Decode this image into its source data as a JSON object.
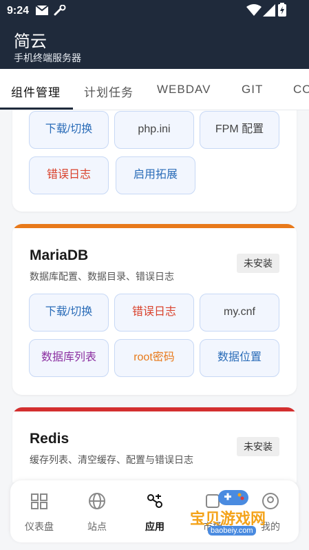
{
  "status": {
    "time": "9:24"
  },
  "app": {
    "title": "简云",
    "subtitle": "手机终端服务器"
  },
  "tabs": [
    {
      "label": "组件管理",
      "active": true
    },
    {
      "label": "计划任务"
    },
    {
      "label": "WEBDAV"
    },
    {
      "label": "GIT"
    },
    {
      "label": "CO"
    }
  ],
  "php_card": {
    "buttons": [
      {
        "label": "下载/切换",
        "color": "#2a6cb8"
      },
      {
        "label": "php.ini",
        "color": "#444444"
      },
      {
        "label": "FPM 配置",
        "color": "#444444"
      },
      {
        "label": "错误日志",
        "color": "#d9412b"
      },
      {
        "label": "启用拓展",
        "color": "#2a6cb8"
      }
    ]
  },
  "mariadb": {
    "title": "MariaDB",
    "desc": "数据库配置、数据目录、错误日志",
    "badge": "未安装",
    "accent": "#e8791a",
    "buttons": [
      {
        "label": "下载/切换",
        "color": "#2a6cb8"
      },
      {
        "label": "错误日志",
        "color": "#d9412b"
      },
      {
        "label": "my.cnf",
        "color": "#444444"
      },
      {
        "label": "数据库列表",
        "color": "#8b2fa0"
      },
      {
        "label": "root密码",
        "color": "#e8791a"
      },
      {
        "label": "数据位置",
        "color": "#2a6cb8"
      }
    ]
  },
  "redis": {
    "title": "Redis",
    "desc": "缓存列表、清空缓存、配置与错误日志",
    "badge": "未安装",
    "accent": "#d32f2f"
  },
  "nav": [
    {
      "label": "仪表盘",
      "icon": "dashboard-icon"
    },
    {
      "label": "站点",
      "icon": "globe-icon"
    },
    {
      "label": "应用",
      "icon": "apps-icon",
      "active": true
    },
    {
      "label": "市场",
      "icon": "store-icon"
    },
    {
      "label": "我的",
      "icon": "user-icon"
    }
  ],
  "watermark": {
    "text": "宝贝游戏网",
    "url": "baobeiy.com"
  }
}
